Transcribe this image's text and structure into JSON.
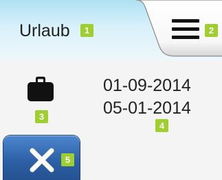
{
  "header": {
    "title": "Urlaub",
    "title_badge": "1",
    "menu_icon": "hamburger-menu-icon",
    "menu_badge": "2"
  },
  "vacation": {
    "icon": "suitcase-icon",
    "icon_badge": "3",
    "start_date": "01-09-2014",
    "end_date": "05-01-2014",
    "dates_badge": "4"
  },
  "footer": {
    "cancel_icon": "close-x-icon",
    "cancel_badge": "5"
  },
  "colors": {
    "header_gradient_top": "#aee1f4",
    "badge": "#9fce2f",
    "cancel_button": "#2c5fa5",
    "text": "#222222"
  }
}
